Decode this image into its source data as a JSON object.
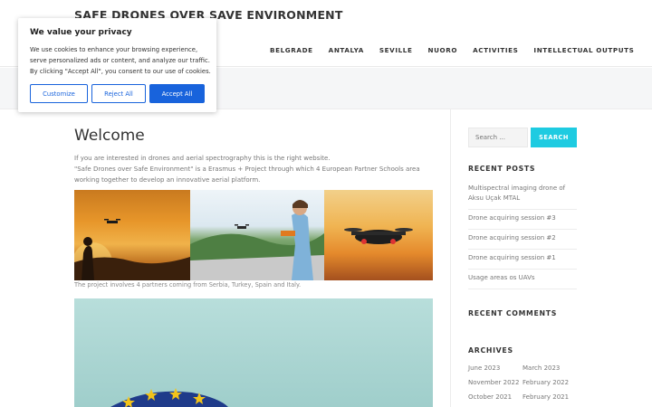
{
  "header": {
    "site_title": "SAFE DRONES OVER SAVE ENVIRONMENT",
    "nav": [
      "BELGRADE",
      "ANTALYA",
      "SEVILLE",
      "NUORO",
      "ACTIVITIES",
      "INTELLECTUAL OUTPUTS"
    ]
  },
  "main": {
    "heading": "Welcome",
    "intro_line1": "If you are interested in drones and aerial spectrography this is the right website.",
    "intro_line2": "\"Safe Drones over Safe Environment\" is a Erasmus + Project through which 4 European Partner Schools area working together to develop an innovative aerial platform.",
    "caption": "The project involves 4 partners coming from Serbia, Turkey, Spain and Italy."
  },
  "sidebar": {
    "search_placeholder": "Search ...",
    "search_button": "SEARCH",
    "recent_posts_title": "RECENT POSTS",
    "recent_posts": [
      "Multispectral imaging drone of Aksu Uçak MTAL",
      "Drone acquiring session #3",
      "Drone acquiring session #2",
      "Drone acquiring session #1",
      "Usage areas os UAVs"
    ],
    "recent_comments_title": "RECENT COMMENTS",
    "archives_title": "ARCHIVES",
    "archives": [
      "June 2023",
      "March 2023",
      "November 2022",
      "February 2022",
      "October 2021",
      "February 2021"
    ]
  },
  "cookie": {
    "title": "We value your privacy",
    "text": "We use cookies to enhance your browsing experience, serve personalized ads or content, and analyze our traffic. By clicking \"Accept All\", you consent to our use of cookies.",
    "customize": "Customize",
    "reject": "Reject All",
    "accept": "Accept All"
  },
  "colors": {
    "accent": "#1ecbe1",
    "cookie_blue": "#1863dc"
  }
}
